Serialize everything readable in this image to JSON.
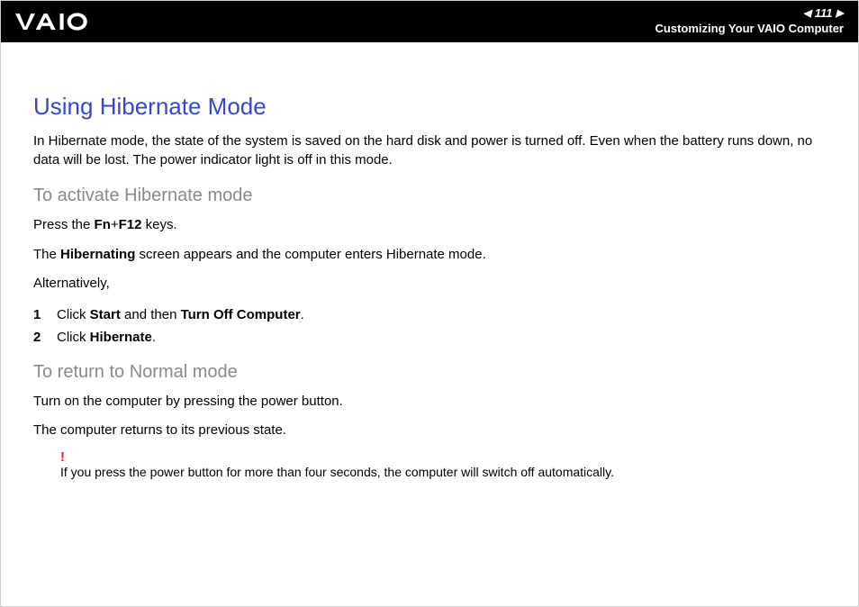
{
  "header": {
    "page_number": "111",
    "section_title": "Customizing Your VAIO Computer"
  },
  "content": {
    "title": "Using Hibernate Mode",
    "intro": "In Hibernate mode, the state of the system is saved on the hard disk and power is turned off. Even when the battery runs down, no data will be lost. The power indicator light is off in this mode.",
    "section1": {
      "heading": "To activate Hibernate mode",
      "p1_pre": "Press the ",
      "p1_b1": "Fn",
      "p1_mid": "+",
      "p1_b2": "F12",
      "p1_post": " keys.",
      "p2_pre": "The ",
      "p2_b": "Hibernating",
      "p2_post": " screen appears and the computer enters Hibernate mode.",
      "p3": "Alternatively,",
      "steps": [
        {
          "num": "1",
          "pre": "Click ",
          "b1": "Start",
          "mid": " and then ",
          "b2": "Turn Off Computer",
          "post": "."
        },
        {
          "num": "2",
          "pre": "Click ",
          "b1": "Hibernate",
          "mid": "",
          "b2": "",
          "post": "."
        }
      ]
    },
    "section2": {
      "heading": "To return to Normal mode",
      "p1": "Turn on the computer by pressing the power button.",
      "p2": "The computer returns to its previous state."
    },
    "warning": {
      "mark": "!",
      "text": "If you press the power button for more than four seconds, the computer will switch off automatically."
    }
  }
}
